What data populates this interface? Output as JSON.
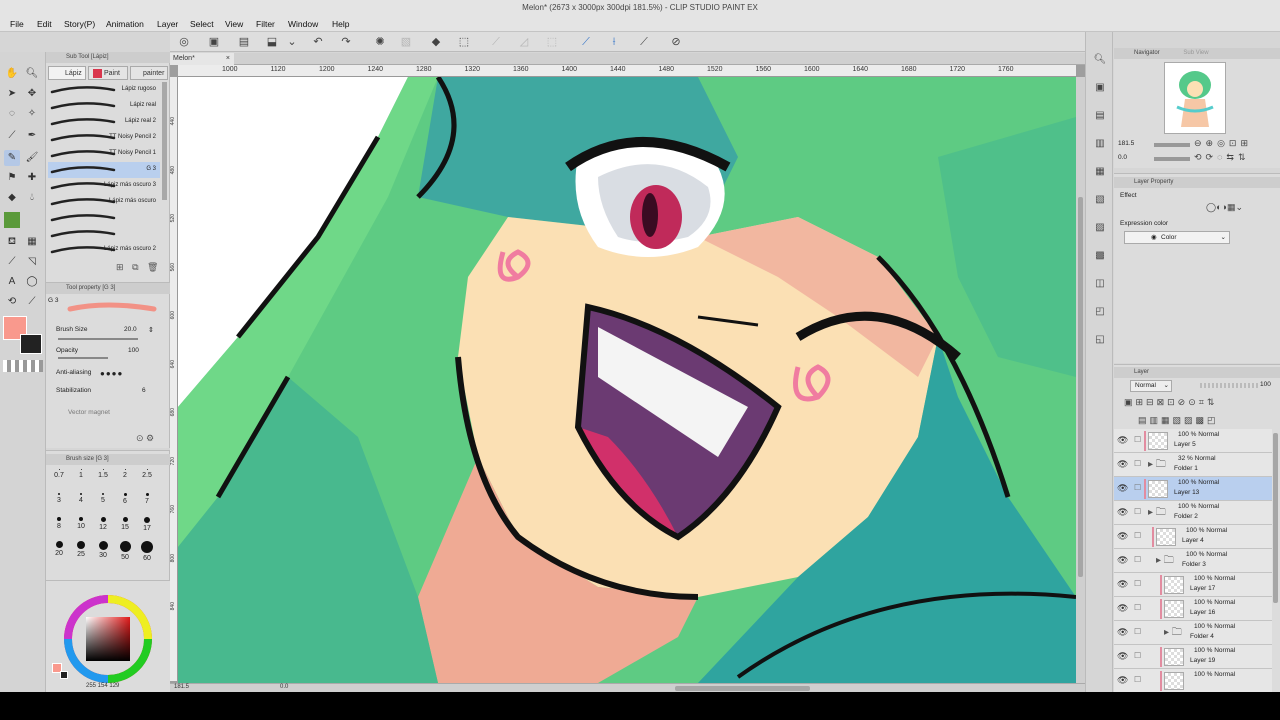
{
  "window": {
    "title": "Melon* (2673 x 3000px 300dpi 181.5%) - CLIP STUDIO PAINT EX"
  },
  "menu": [
    "File",
    "Edit",
    "Story(P)",
    "Animation",
    "Layer",
    "Select",
    "View",
    "Filter",
    "Window",
    "Help"
  ],
  "document": {
    "tab": "Melon*",
    "zoom": "181.5",
    "rotation": "0.0"
  },
  "ruler": {
    "h_ticks": [
      "1000",
      "1120",
      "1200",
      "1240",
      "1280",
      "1320",
      "1360",
      "1400",
      "1440",
      "1480",
      "1520",
      "1560",
      "1600",
      "1640",
      "1680",
      "1720",
      "1760"
    ],
    "v_ticks": [
      "440",
      "480",
      "520",
      "560",
      "600",
      "640",
      "680",
      "720",
      "760",
      "800",
      "840"
    ]
  },
  "subtool": {
    "title": "Sub Tool [Lápiz]",
    "tabs": [
      "Lápiz",
      "Paint",
      "painter"
    ],
    "brushes": [
      "Lápiz rugoso",
      "Lápiz real",
      "Lápiz real 2",
      "TT Noisy Pencil 2",
      "TT Noisy Pencil 1",
      "G 3",
      "Lápiz más oscuro 3",
      "Lápiz más oscuro",
      "",
      "",
      "Lápiz más oscuro 2"
    ],
    "selected": "G 3"
  },
  "tool_property": {
    "title": "Tool property [G 3]",
    "subtitle": "G 3",
    "brush_size_label": "Brush Size",
    "brush_size": "20.0",
    "opacity_label": "Opacity",
    "opacity": "100",
    "antialias_label": "Anti-aliasing",
    "stabilization_label": "Stabilization",
    "stabilization": "6",
    "vector_magnet_label": "Vector magnet"
  },
  "brush_size_panel": {
    "title": "Brush size [G 3]",
    "sizes": [
      "0.7",
      "1",
      "1.5",
      "2",
      "2.5",
      "3",
      "4",
      "5",
      "6",
      "7",
      "8",
      "10",
      "12",
      "15",
      "17",
      "20",
      "25",
      "30",
      "50",
      "60"
    ]
  },
  "color": {
    "rgb_text": "255 154 129",
    "main": "#f9998d",
    "sub": "#222222"
  },
  "navigator": {
    "title": "Navigator",
    "tab2": "Sub View",
    "zoom": "181.5",
    "angle": "0.0"
  },
  "layer_property": {
    "title": "Layer Property",
    "effect_label": "Effect",
    "expression_label": "Expression color",
    "expression_value": "Color"
  },
  "layer_panel": {
    "title": "Layer",
    "blend": "Normal",
    "opacity": "100",
    "layers": [
      {
        "mode": "100 % Normal",
        "name": "Layer 5",
        "type": "layer",
        "indent": 0,
        "selected": false
      },
      {
        "mode": "32 % Normal",
        "name": "Folder 1",
        "type": "folder",
        "indent": 0,
        "selected": false
      },
      {
        "mode": "100 % Normal",
        "name": "Layer 13",
        "type": "layer",
        "indent": 0,
        "selected": true
      },
      {
        "mode": "100 % Normal",
        "name": "Folder 2",
        "type": "folder",
        "indent": 0,
        "selected": false
      },
      {
        "mode": "100 % Normal",
        "name": "Layer 4",
        "type": "layer",
        "indent": 1,
        "selected": false
      },
      {
        "mode": "100 % Normal",
        "name": "Folder 3",
        "type": "folder",
        "indent": 1,
        "selected": false
      },
      {
        "mode": "100 % Normal",
        "name": "Layer 17",
        "type": "layer",
        "indent": 2,
        "selected": false
      },
      {
        "mode": "100 % Normal",
        "name": "Layer 16",
        "type": "layer",
        "indent": 2,
        "selected": false
      },
      {
        "mode": "100 % Normal",
        "name": "Folder 4",
        "type": "folder",
        "indent": 2,
        "selected": false
      },
      {
        "mode": "100 % Normal",
        "name": "Layer 19",
        "type": "layer",
        "indent": 2,
        "selected": false
      },
      {
        "mode": "100 % Normal",
        "name": "",
        "type": "layer",
        "indent": 2,
        "selected": false
      }
    ]
  },
  "statusbar": {
    "zoom": "181.5",
    "angle": "0.0"
  }
}
